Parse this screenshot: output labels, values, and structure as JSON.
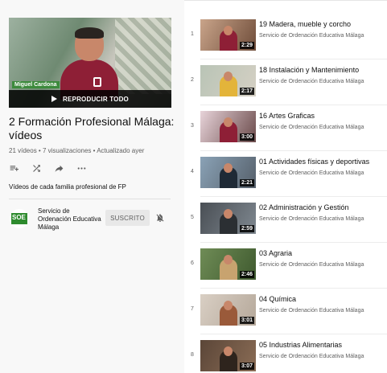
{
  "playlist": {
    "play_all_label": "REPRODUCIR TODO",
    "thumb_caption": "Miguel Cardona",
    "title": "2 Formación Profesional Málaga: vídeos",
    "stats": "21 vídeos • 7 visualizaciones • Actualizado ayer",
    "description": "Vídeos de cada familia profesional de FP",
    "actions": [
      "add-to-queue-icon",
      "shuffle-icon",
      "share-icon",
      "more-icon"
    ]
  },
  "owner": {
    "name": "Servicio de Ordenación Educativa Málaga",
    "subscribe_label": "SUSCRITO",
    "avatar_text": "SOE"
  },
  "videos": [
    {
      "index": "1",
      "title": "19 Madera, mueble y corcho",
      "channel": "Servicio de Ordenación Educativa Málaga",
      "duration": "2:29"
    },
    {
      "index": "2",
      "title": "18 Instalación y Mantenimiento",
      "channel": "Servicio de Ordenación Educativa Málaga",
      "duration": "2:17"
    },
    {
      "index": "3",
      "title": "16 Artes Graficas",
      "channel": "Servicio de Ordenación Educativa Málaga",
      "duration": "3:00"
    },
    {
      "index": "4",
      "title": "01 Actividades físicas y deportivas",
      "channel": "Servicio de Ordenación Educativa Málaga",
      "duration": "2:21"
    },
    {
      "index": "5",
      "title": "02 Administración y Gestión",
      "channel": "Servicio de Ordenación Educativa Málaga",
      "duration": "2:59"
    },
    {
      "index": "6",
      "title": "03 Agraria",
      "channel": "Servicio de Ordenación Educativa Málaga",
      "duration": "2:46"
    },
    {
      "index": "7",
      "title": "04 Química",
      "channel": "Servicio de Ordenación Educativa Málaga",
      "duration": "3:01"
    },
    {
      "index": "8",
      "title": "05 Industrias Alimentarias",
      "channel": "Servicio de Ordenación Educativa Málaga",
      "duration": "3:07"
    }
  ],
  "colors": {
    "brand_green": "#2e8b2e",
    "shirt": "#8e1f36",
    "text_primary": "#0f0f0f",
    "text_secondary": "#606060"
  }
}
